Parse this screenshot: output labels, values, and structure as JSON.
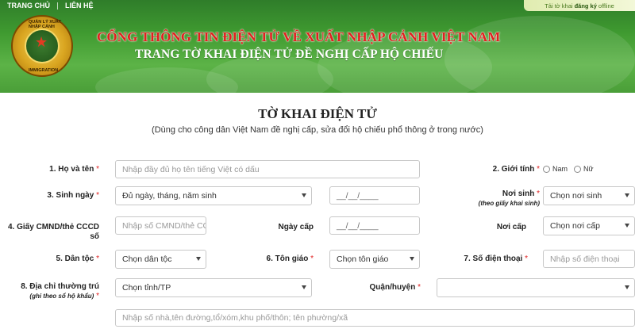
{
  "nav": {
    "home": "TRANG CHỦ",
    "contact": "LIÊN HỆ"
  },
  "offline": {
    "pre": "Tải tờ khai",
    "strong": "đăng ký",
    "post": "offline"
  },
  "emblem": {
    "top": "QUẢN LÝ XUẤT NHẬP CẢNH",
    "bottom": "IMMIGRATION"
  },
  "header": {
    "title": "CỔNG THÔNG TIN ĐIỆN TỬ VỀ XUẤT NHẬP CẢNH VIỆT NAM",
    "subtitle": "TRANG TỜ KHAI ĐIỆN TỬ ĐỀ NGHỊ CẤP HỘ CHIẾU"
  },
  "form": {
    "title": "TỜ KHAI ĐIỆN TỬ",
    "subtitle": "(Dùng cho công dân Việt Nam đề nghị cấp, sửa đổi hộ chiếu phổ thông ở trong nước)",
    "required": "*",
    "name": {
      "label": "1. Họ và tên",
      "placeholder": "Nhập đầy đủ họ tên tiếng Việt có dấu"
    },
    "gender": {
      "label": "2. Giới tính",
      "male": "Nam",
      "female": "Nữ"
    },
    "dob": {
      "label": "3. Sinh ngày",
      "select": "Đủ ngày, tháng, năm sinh",
      "date": "__/__/____"
    },
    "birthplace": {
      "label": "Nơi sinh",
      "note": "(theo giấy khai sinh)",
      "select": "Chọn nơi sinh"
    },
    "id": {
      "label": "4. Giấy CMND/thẻ CCCD số",
      "placeholder": "Nhập số CMND/thẻ CCCD"
    },
    "issue_date": {
      "label": "Ngày cấp",
      "date": "__/__/____"
    },
    "issue_place": {
      "label": "Nơi cấp",
      "select": "Chọn nơi cấp"
    },
    "ethnicity": {
      "label": "5. Dân tộc",
      "select": "Chọn dân tộc"
    },
    "religion": {
      "label": "6. Tôn giáo",
      "select": "Chọn tôn giáo"
    },
    "phone": {
      "label": "7. Số điện thoại",
      "placeholder": "Nhập số điện thoại"
    },
    "address": {
      "label": "8. Địa chỉ thường trú",
      "note": "(ghi theo sổ hộ khẩu)",
      "province": "Chọn tỉnh/TP",
      "district_label": "Quận/huyện",
      "district": "",
      "street_placeholder": "Nhập số nhà,tên đường,tổ/xóm,khu phố/thôn; tên phường/xã"
    }
  }
}
